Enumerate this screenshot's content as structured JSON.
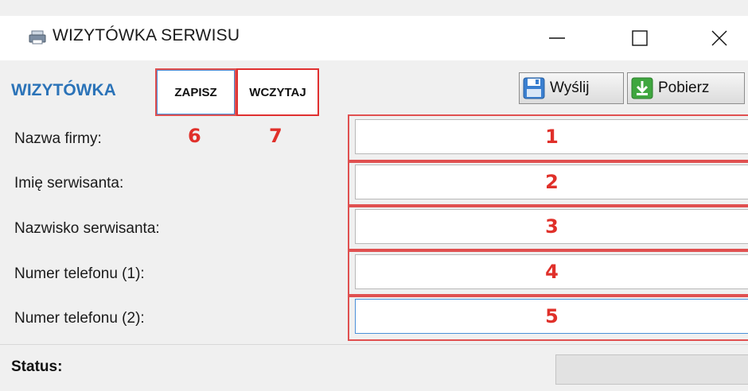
{
  "window": {
    "title": "WIZYTÓWKA SERWISU",
    "icon": "printer-icon",
    "controls": {
      "minimize": "minimize-icon",
      "maximize": "maximize-icon",
      "close": "close-icon"
    }
  },
  "toolbar": {
    "brand": "WIZYTÓWKA",
    "save_label": "ZAPISZ",
    "load_label": "WCZYTAJ",
    "send_label": "Wyślij",
    "download_label": "Pobierz"
  },
  "annotations": {
    "save": "6",
    "load": "7",
    "fields": [
      "1",
      "2",
      "3",
      "4",
      "5"
    ]
  },
  "form": {
    "fields": [
      {
        "label": "Nazwa firmy:",
        "value": ""
      },
      {
        "label": "Imię serwisanta:",
        "value": ""
      },
      {
        "label": "Nazwisko serwisanta:",
        "value": ""
      },
      {
        "label": "Numer telefonu (1):",
        "value": ""
      },
      {
        "label": "Numer telefonu (2):",
        "value": ""
      }
    ]
  },
  "status": {
    "label": "Status:",
    "value": ""
  },
  "colors": {
    "brand": "#2b73b8",
    "annotation": "#e0302a",
    "focus": "#4a90d9"
  }
}
